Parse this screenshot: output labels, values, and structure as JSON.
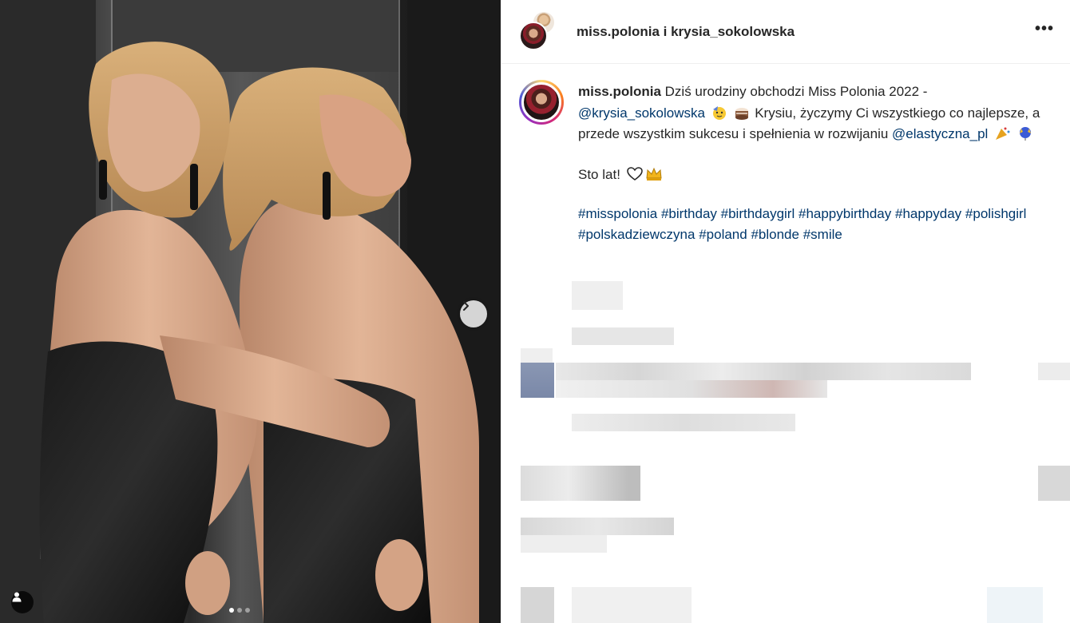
{
  "header": {
    "title": "miss.polonia i krysia_sokolowska",
    "more_label": "•••"
  },
  "caption": {
    "username": "miss.polonia",
    "text_1": " Dziś urodziny obchodzi Miss Polonia 2022 - ",
    "mention_1": "@krysia_sokolowska",
    "text_2": " Krysiu, życzymy Ci wszystkiego co najlepsze, a przede wszystkim sukcesu i spełnienia w rozwijaniu ",
    "mention_2": "@elastyczna_pl",
    "sto_lat": "Sto lat!",
    "hashtags": [
      "#misspolonia",
      "#birthday",
      "#birthdaygirl",
      "#happybirthday",
      "#happyday",
      "#polishgirl",
      "#polskadziewczyna",
      "#poland",
      "#blonde",
      "#smile"
    ]
  },
  "media": {
    "carousel_total": 3,
    "carousel_active": 1,
    "next_icon": "chevron-right-icon",
    "tag_icon": "person-icon"
  },
  "colors": {
    "link": "#00376b",
    "text": "#262626",
    "border": "#efefef"
  }
}
